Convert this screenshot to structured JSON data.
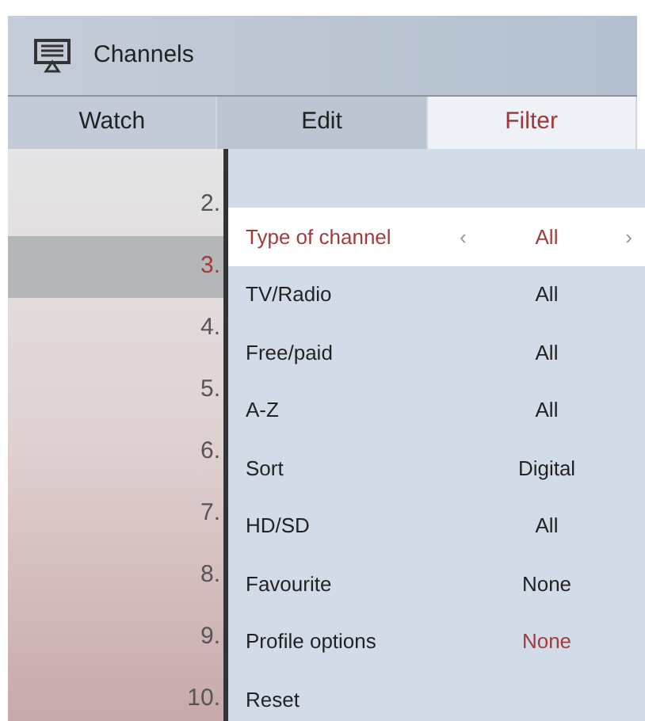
{
  "header": {
    "title": "Channels"
  },
  "tabs": [
    {
      "label": "Watch",
      "selected": false
    },
    {
      "label": "Edit",
      "selected": false
    },
    {
      "label": "Filter",
      "selected": true
    }
  ],
  "channel_list": [
    {
      "number": "2.",
      "selected": false
    },
    {
      "number": "3.",
      "selected": true
    },
    {
      "number": "4.",
      "selected": false
    },
    {
      "number": "5.",
      "selected": false
    },
    {
      "number": "6.",
      "selected": false
    },
    {
      "number": "7.",
      "selected": false
    },
    {
      "number": "8.",
      "selected": false
    },
    {
      "number": "9.",
      "selected": false
    },
    {
      "number": "10.",
      "selected": false
    }
  ],
  "filters": [
    {
      "label": "Type of channel",
      "value": "All",
      "selected": true,
      "highlighted": false,
      "prev": "‹",
      "next": "›"
    },
    {
      "label": "TV/Radio",
      "value": "All",
      "selected": false,
      "highlighted": false
    },
    {
      "label": "Free/paid",
      "value": "All",
      "selected": false,
      "highlighted": false
    },
    {
      "label": "A-Z",
      "value": "All",
      "selected": false,
      "highlighted": false
    },
    {
      "label": "Sort",
      "value": "Digital",
      "selected": false,
      "highlighted": false
    },
    {
      "label": "HD/SD",
      "value": "All",
      "selected": false,
      "highlighted": false
    },
    {
      "label": "Favourite",
      "value": "None",
      "selected": false,
      "highlighted": false
    },
    {
      "label": "Profile options",
      "value": "None",
      "selected": false,
      "highlighted": true
    },
    {
      "label": "Reset",
      "selected": false
    }
  ]
}
